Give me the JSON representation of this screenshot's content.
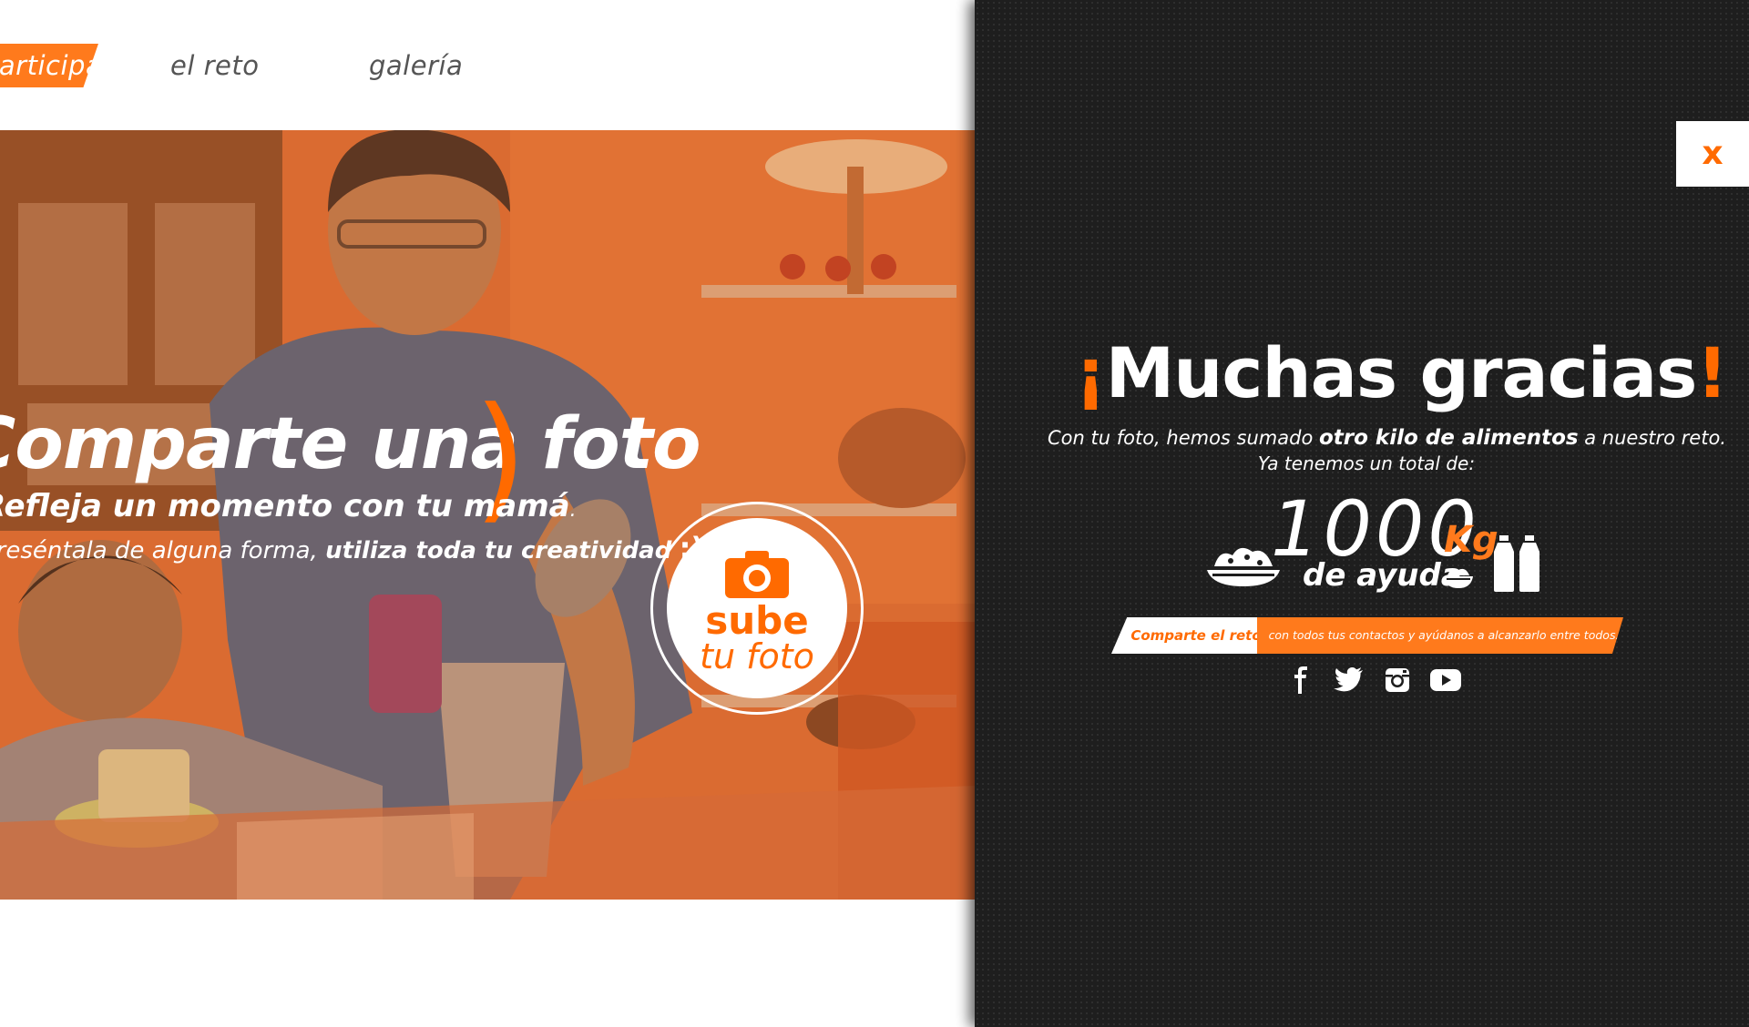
{
  "nav": {
    "items": [
      {
        "label": "participa",
        "active": true
      },
      {
        "label": "el reto",
        "active": false
      },
      {
        "label": "galería",
        "active": false
      }
    ]
  },
  "hero": {
    "title": "Comparte una foto",
    "paren": ")",
    "subtitle_bold": "Refleja un momento con tu mamá",
    "subtitle_end": ".",
    "line2_regular": "Preséntala de alguna forma, ",
    "line2_bold": "utiliza toda tu creatividad",
    "line2_wink": ";)",
    "upload_line1": "sube",
    "upload_line2": "tu foto"
  },
  "overlay": {
    "close_label": "x",
    "thanks_open": "¡",
    "thanks_main": "Muchas gracias",
    "thanks_close": "!",
    "msg_pre": "Con tu foto, hemos sumado ",
    "msg_bold": "otro kilo de alimentos",
    "msg_post": " a nuestro reto.",
    "msg_line2": "Ya tenemos un total de:",
    "total": "1000",
    "unit": "Kg",
    "help_label": "de ayuda",
    "share_button": "Comparte el reto",
    "share_text": "con todos tus contactos y ayúdanos a alcanzarlo entre todos.",
    "social": [
      "facebook-icon",
      "twitter-icon",
      "instagram-icon",
      "youtube-icon"
    ]
  },
  "colors": {
    "accent": "#ff6a00",
    "accent_light": "#ff7a1c",
    "panel_bg": "#1e1e1e",
    "text_light": "#ffffff"
  }
}
